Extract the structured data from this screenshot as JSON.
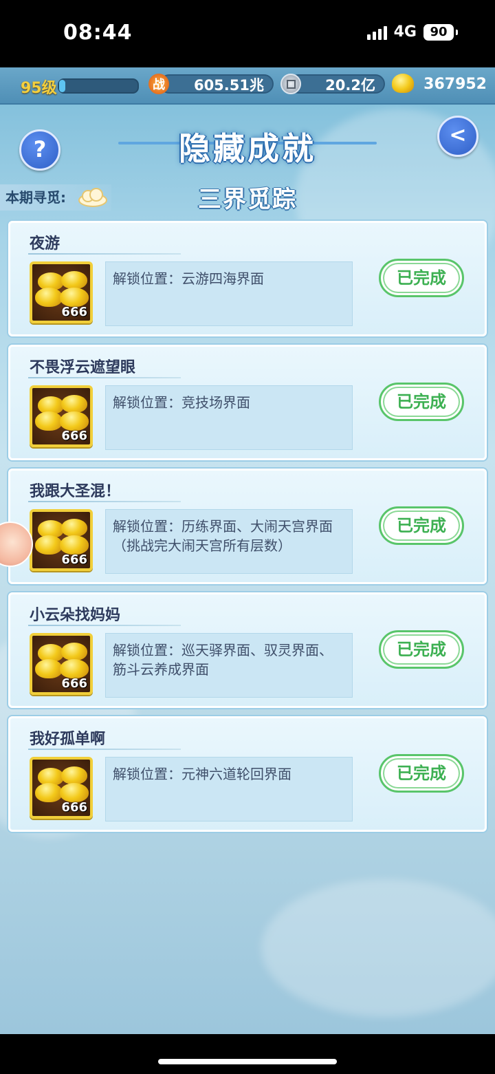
{
  "status_bar": {
    "time": "08:44",
    "network": "4G",
    "battery": "90"
  },
  "top_bar": {
    "level": "95级",
    "level_progress": 0.08,
    "combat_icon": "战",
    "combat_power": "605.51兆",
    "silver": "20.2亿",
    "gold": "367952"
  },
  "header": {
    "title": "隐藏成就",
    "help_icon": "?",
    "back_icon": "<"
  },
  "period": {
    "label": "本期寻觅:",
    "subtitle": "三界觅踪"
  },
  "achievements": [
    {
      "name": "夜游",
      "reward_count": "666",
      "desc": "解锁位置：云游四海界面",
      "status": "已完成"
    },
    {
      "name": "不畏浮云遮望眼",
      "reward_count": "666",
      "desc": "解锁位置：竞技场界面",
      "status": "已完成"
    },
    {
      "name": "我跟大圣混！",
      "reward_count": "666",
      "desc": "解锁位置：历练界面、大闹天宫界面（挑战完大闹天宫所有层数）",
      "status": "已完成"
    },
    {
      "name": "小云朵找妈妈",
      "reward_count": "666",
      "desc": "解锁位置：巡天驿界面、驭灵界面、筋斗云养成界面",
      "status": "已完成"
    },
    {
      "name": "我好孤单啊",
      "reward_count": "666",
      "desc": "解锁位置：元神六道轮回界面",
      "status": "已完成"
    }
  ],
  "colors": {
    "done_green": "#3db052",
    "title_blue": "#2f6fb0",
    "gold_border": "#f1cf3a"
  }
}
